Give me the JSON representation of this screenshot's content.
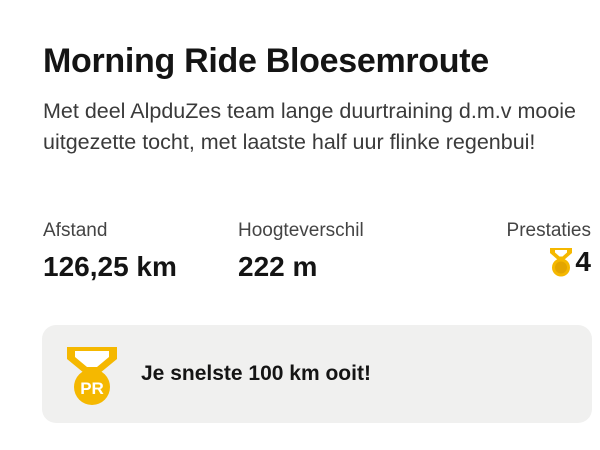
{
  "activity": {
    "title": "Morning Ride Bloesemroute",
    "description": "Met deel AlpduZes team lange duurtraining d.m.v mooie uitgezette tocht, met laatste half uur flinke regenbui!"
  },
  "stats": {
    "distance": {
      "label": "Afstand",
      "value": "126,25 km"
    },
    "elevation": {
      "label": "Hoogteverschil",
      "value": "222 m"
    },
    "achievements": {
      "label": "Prestaties",
      "count": "4",
      "icon": "medal-icon"
    }
  },
  "highlight": {
    "icon": "pr-medal-icon",
    "badge": "PR",
    "text": "Je snelste 100 km ooit!"
  },
  "colors": {
    "medal_gold": "#F5B800",
    "medal_dark": "#E3A500",
    "banner_bg": "#F0F0EF",
    "text_primary": "#141414",
    "text_secondary": "#3A3A3A"
  }
}
